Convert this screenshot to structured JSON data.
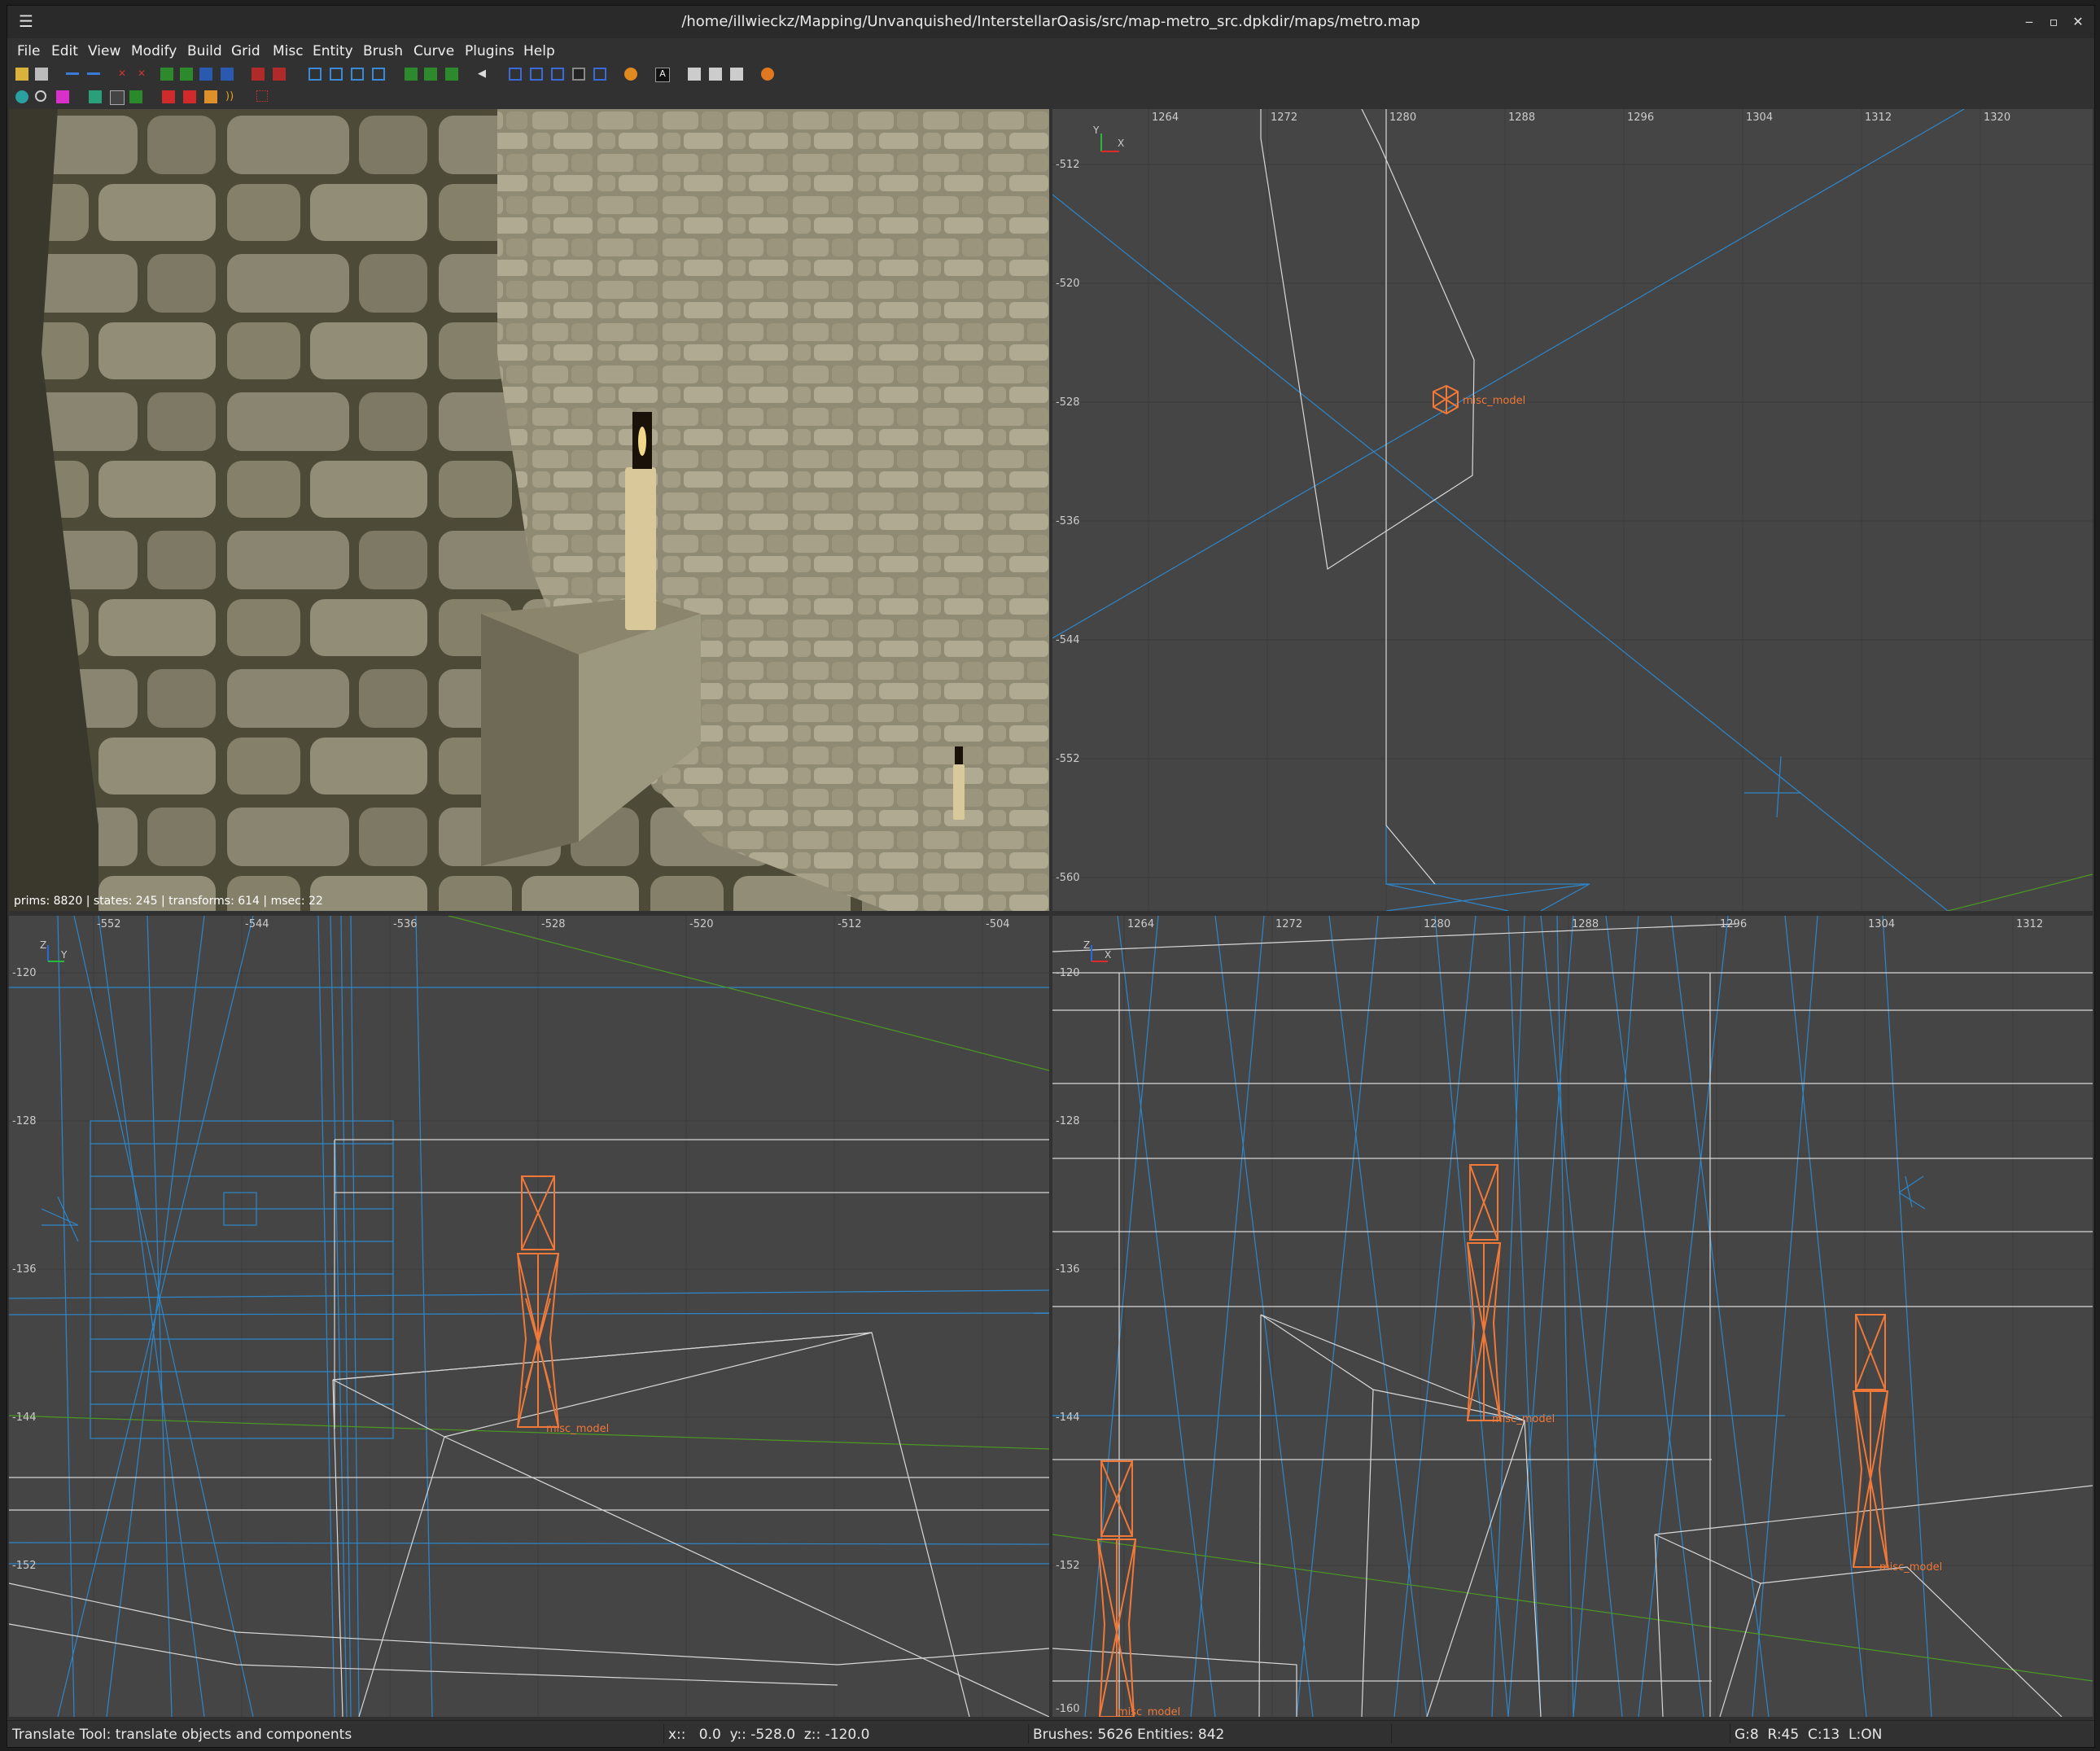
{
  "window": {
    "title": "/home/illwieckz/Mapping/Unvanquished/InterstellarOasis/src/map-metro_src.dpkdir/maps/metro.map",
    "menu_icon": "hamburger-icon",
    "controls": [
      "minimize-icon",
      "maximize-icon",
      "close-icon"
    ]
  },
  "menu": [
    "File",
    "Edit",
    "View",
    "Modify",
    "Build",
    "Grid",
    "Misc",
    "Entity",
    "Brush",
    "Curve",
    "Plugins",
    "Help"
  ],
  "colors": {
    "viewport_bg": "#454545",
    "grid_line": "#3a3a3a",
    "brush_wire": "#d8d8d8",
    "blue_wire": "#2e86c9",
    "entity_orange": "#f07838",
    "green_line": "#4a9a20"
  },
  "camera_view": {
    "stats": "prims: 8820 | states: 245 | transforms: 614 | msec: 22"
  },
  "xy_view": {
    "x_ticks": [
      "1264",
      "1272",
      "1280",
      "1288",
      "1296",
      "1304",
      "1312",
      "1320"
    ],
    "y_ticks": [
      "-512",
      "-520",
      "-528",
      "-536",
      "-544",
      "-552",
      "-560"
    ],
    "axis_labels": [
      "Y",
      "X"
    ],
    "entity_label": "misc_model"
  },
  "yz_view": {
    "x_ticks": [
      "-552",
      "-544",
      "-536",
      "-528",
      "-520",
      "-512",
      "-504"
    ],
    "y_ticks": [
      "-120",
      "-128",
      "-136",
      "-144",
      "-152"
    ],
    "axis_labels": [
      "Z",
      "Y"
    ],
    "entity_label": "misc_model"
  },
  "xz_view": {
    "x_ticks": [
      "1264",
      "1272",
      "1280",
      "1288",
      "1296",
      "1304",
      "1312"
    ],
    "y_ticks": [
      "-120",
      "-128",
      "-136",
      "-144",
      "-152",
      "-160"
    ],
    "axis_labels": [
      "Z",
      "X"
    ],
    "entity_labels": [
      "misc_model",
      "misc_model",
      "misc_model"
    ]
  },
  "status": {
    "tool": "Translate Tool: translate objects and components",
    "coords": "x::   0.0  y:: -528.0  z:: -120.0",
    "counts": "Brushes: 5626 Entities: 842",
    "grid": "G:8  R:45  C:13  L:ON"
  }
}
